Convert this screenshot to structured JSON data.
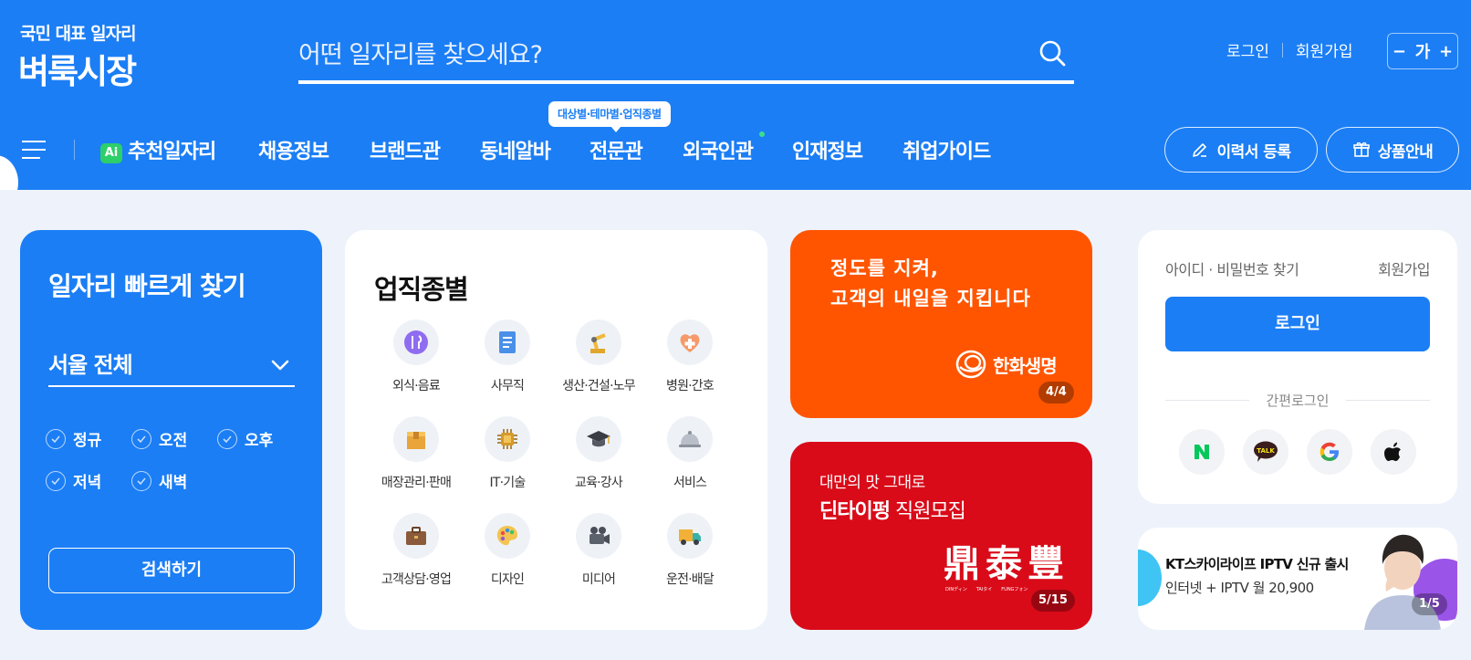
{
  "header": {
    "logo_small": "국민 대표 일자리",
    "logo_big": "벼룩시장",
    "search_placeholder": "어떤 일자리를 찾으세요?",
    "login": "로그인",
    "signup": "회원가입",
    "font_minus": "−",
    "font_label": "가",
    "font_plus": "+"
  },
  "nav": {
    "ai_badge": "Ai",
    "items": [
      "추천일자리",
      "채용정보",
      "브랜드관",
      "동네알바",
      "전문관",
      "외국인관",
      "인재정보",
      "취업가이드"
    ],
    "tooltip": "대상별·테마별·업직종별",
    "resume_button": "이력서 등록",
    "product_button": "상품안내"
  },
  "quick_search": {
    "title": "일자리 빠르게 찾기",
    "region": "서울 전체",
    "options": [
      "정규",
      "오전",
      "오후",
      "저녁",
      "새벽"
    ],
    "button": "검색하기"
  },
  "job_categories": {
    "title": "업직종별",
    "items": [
      {
        "label": "외식·음료",
        "icon": "utensils-icon"
      },
      {
        "label": "사무직",
        "icon": "document-icon"
      },
      {
        "label": "생산·건설·노무",
        "icon": "robot-arm-icon"
      },
      {
        "label": "병원·간호",
        "icon": "heart-cross-icon"
      },
      {
        "label": "매장관리·판매",
        "icon": "box-icon"
      },
      {
        "label": "IT·기술",
        "icon": "chip-icon"
      },
      {
        "label": "교육·강사",
        "icon": "graduation-cap-icon"
      },
      {
        "label": "서비스",
        "icon": "service-bell-icon"
      },
      {
        "label": "고객상담·영업",
        "icon": "briefcase-icon"
      },
      {
        "label": "디자인",
        "icon": "palette-icon"
      },
      {
        "label": "미디어",
        "icon": "film-camera-icon"
      },
      {
        "label": "운전·배달",
        "icon": "truck-icon"
      }
    ]
  },
  "banner_hanwha": {
    "line1": "정도를 지켜,",
    "line2": "고객의 내일을 지킵니다",
    "brand": "한화생명",
    "pager": "4/4",
    "color": "#ff5500"
  },
  "banner_dintaifung": {
    "sub": "대만의 맛 그대로",
    "brand": "딘타이펑",
    "main_rest": " 직원모집",
    "logo_chars": [
      "鼎",
      "泰",
      "豐"
    ],
    "logo_small": [
      "DINディン",
      "TAIタイ",
      "FUNGフォン"
    ],
    "pager": "5/15",
    "color": "#d90b19"
  },
  "login_box": {
    "find_account": "아이디 · 비밀번호 찾기",
    "signup": "회원가입",
    "login_button": "로그인",
    "easy_login": "간편로그인",
    "providers": [
      "naver-icon",
      "kakao-icon",
      "google-icon",
      "apple-icon"
    ],
    "kakao_label": "TALK"
  },
  "ad": {
    "title": "KT스카이라이프 IPTV 신규 출시",
    "sub": "인터넷 + IPTV 월 20,900",
    "pager": "1/5"
  },
  "colors": {
    "primary": "#1b7ef5",
    "background": "#eef3fb"
  }
}
